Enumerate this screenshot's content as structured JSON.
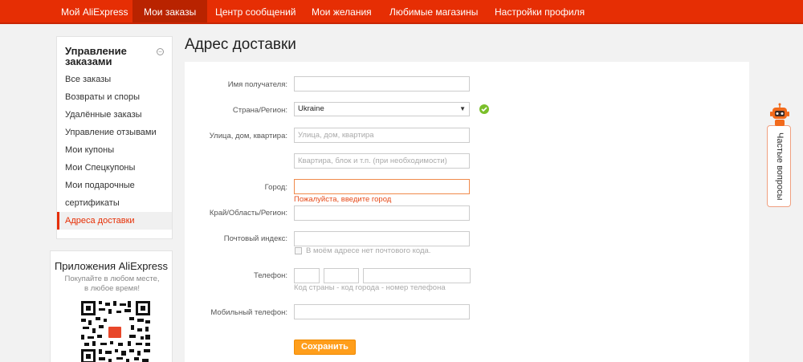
{
  "nav": {
    "items": [
      "Мой AliExpress",
      "Мои заказы",
      "Центр сообщений",
      "Мои желания",
      "Любимые магазины",
      "Настройки профиля"
    ],
    "active_index": 1
  },
  "sidebar": {
    "title": "Управление заказами",
    "toggle_symbol": "−",
    "items": [
      "Все заказы",
      "Возвраты и споры",
      "Удалённые заказы",
      "Управление отзывами",
      "Мои купоны",
      "Мои Спецкупоны",
      "Мои подарочные",
      "сертификаты",
      "Адреса доставки"
    ],
    "active_index": 8
  },
  "app_promo": {
    "title": "Приложения AliExpress",
    "subtitle": "Покупайте в любом месте, в любое время!"
  },
  "page_title": "Адрес доставки",
  "form": {
    "recipient_label": "Имя получателя:",
    "recipient_value": "",
    "country_label": "Страна/Регион:",
    "country_value": "Ukraine",
    "street_label": "Улица, дом, квартира:",
    "street_placeholder": "Улица, дом, квартира",
    "apartment_placeholder": "Квартира, блок и т.п. (при необходимости)",
    "city_label": "Город:",
    "city_error": "Пожалуйста, введите город",
    "region_label": "Край/Область/Регион:",
    "postal_label": "Почтовый индекс:",
    "no_postal_label": "В моём адресе нет почтового кода.",
    "phone_label": "Телефон:",
    "phone_hint": "Код страны - код города - номер телефона",
    "mobile_label": "Мобильный телефон:",
    "save_label": "Сохранить"
  },
  "faq": {
    "label": "Частые вопросы"
  },
  "colors": {
    "brand": "#e62e04",
    "button": "#ff9e1b",
    "error": "#e64a19",
    "success": "#7bbf2a"
  }
}
